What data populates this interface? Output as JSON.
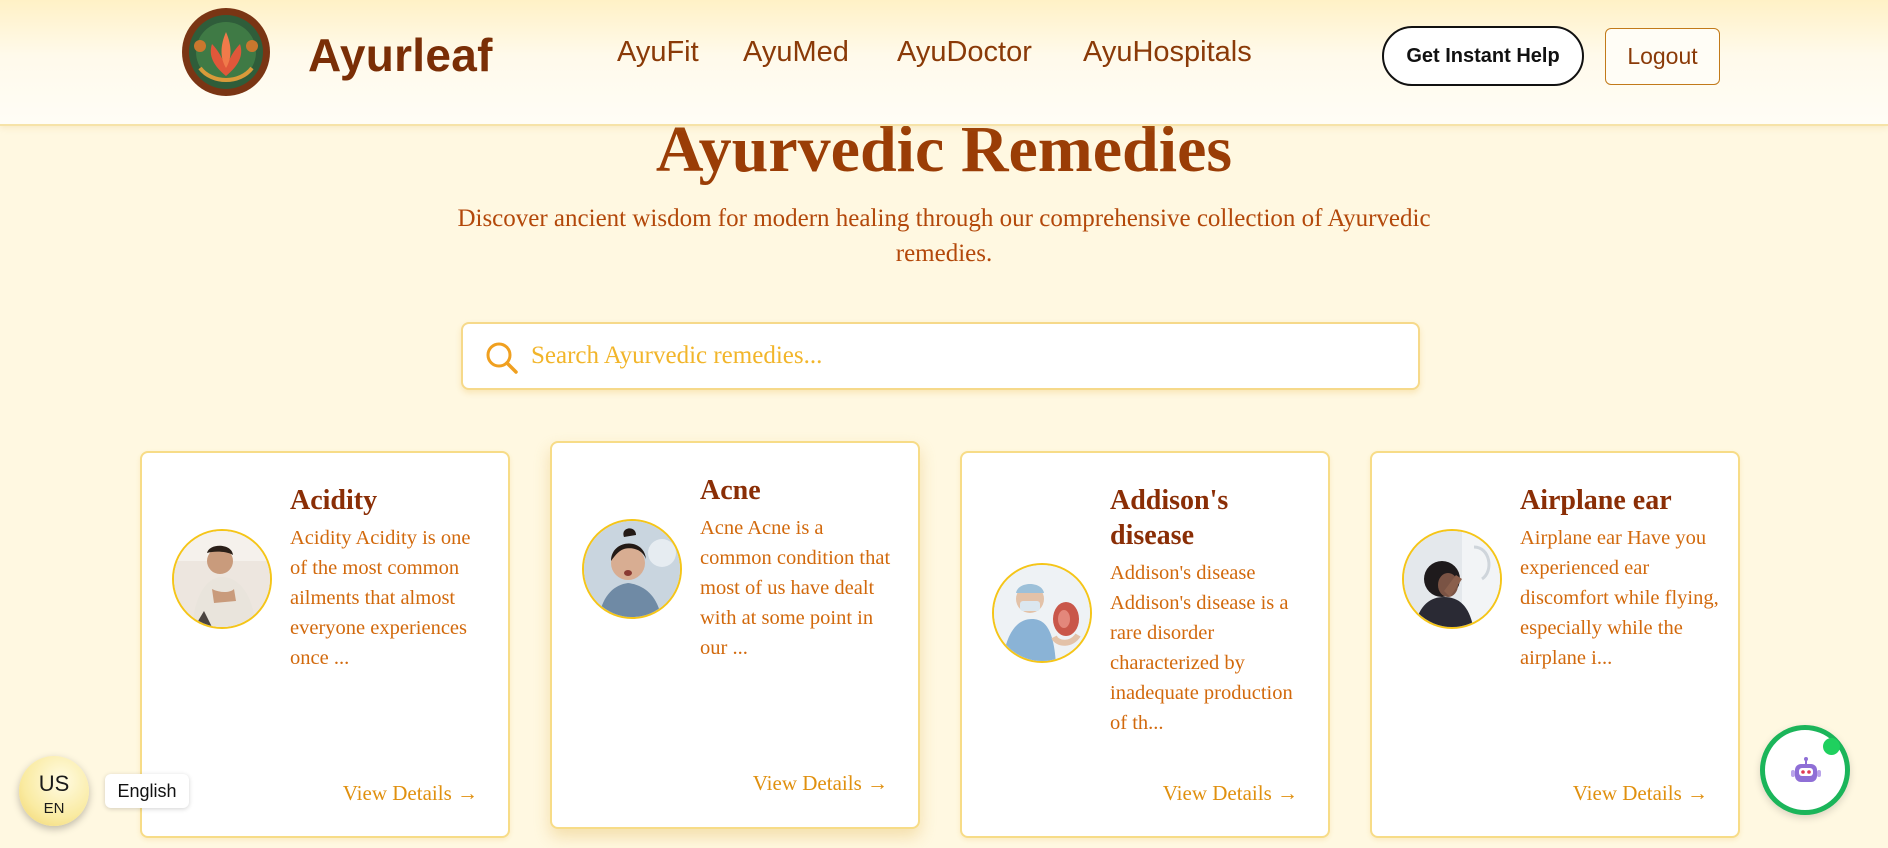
{
  "header": {
    "brand": "Ayurleaf",
    "nav": [
      {
        "label": "AyuFit"
      },
      {
        "label": "AyuMed"
      },
      {
        "label": "AyuDoctor"
      },
      {
        "label": "AyuHospitals"
      }
    ],
    "help_button": "Get Instant Help",
    "logout_button": "Logout"
  },
  "hero": {
    "title": "Ayurvedic Remedies",
    "subtitle": "Discover ancient wisdom for modern healing through our comprehensive collection of Ayurvedic remedies."
  },
  "search": {
    "value": "",
    "placeholder": "Search Ayurvedic remedies..."
  },
  "cards": [
    {
      "title": "Acidity",
      "desc": "Acidity Acidity is one of the most common ailments that almost everyone experiences once ...",
      "link": "View Details →",
      "icon": "person-holding-chest-photo"
    },
    {
      "title": "Acne",
      "desc": "Acne Acne is a common condition that most of us have dealt with at some point in our ...",
      "link": "View Details →",
      "icon": "woman-with-acne-photo"
    },
    {
      "title": "Addison's disease",
      "desc": "Addison's disease Addison's disease is a rare disorder characterized by inadequate production of th...",
      "link": "View Details →",
      "icon": "doctor-with-kidney-photo"
    },
    {
      "title": "Airplane ear",
      "desc": "Airplane ear Have you experienced ear discomfort while flying, especially while the airplane i...",
      "link": "View Details →",
      "icon": "person-holding-ear-photo"
    }
  ],
  "region": {
    "country": "US",
    "language_code": "EN",
    "language": "English"
  },
  "colors": {
    "brand_brown": "#7a2e06",
    "title_brown": "#9a3d06",
    "accent_orange": "#e0900f",
    "background": "#fff8e1",
    "card_border": "#f7dc87",
    "chat_green": "#1bb55a"
  },
  "icons": {
    "logo": "lotus-emblem-icon",
    "search": "search-icon",
    "chat": "chatbot-icon"
  }
}
